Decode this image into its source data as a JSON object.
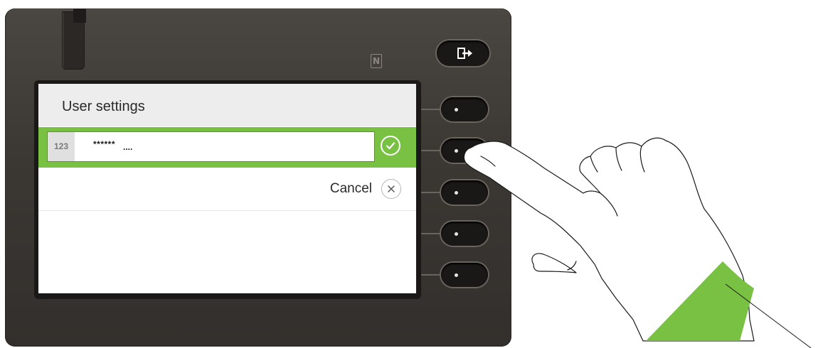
{
  "header": {
    "title": "User settings"
  },
  "input": {
    "prefix": "123",
    "masked_value": "******",
    "cursor": "...."
  },
  "actions": {
    "cancel_label": "Cancel"
  },
  "device": {
    "nfc_label": "N"
  },
  "colors": {
    "accent": "#79c143",
    "device_body": "#3a3632",
    "header_bg": "#ededed"
  },
  "icons": {
    "logout": "logout-icon",
    "confirm": "check-icon",
    "cancel": "close-icon",
    "nfc": "nfc-icon"
  }
}
